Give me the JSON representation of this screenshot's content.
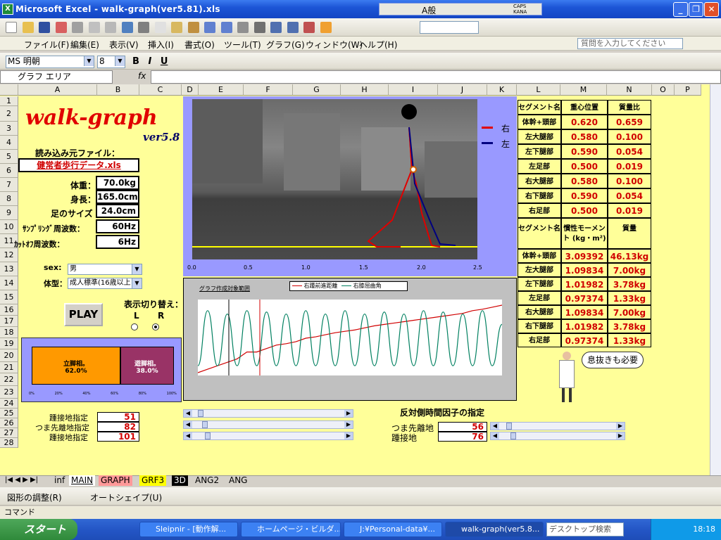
{
  "window": {
    "title": "Microsoft Excel - walk-graph(ver5.81).xls",
    "ime_mode": "A般",
    "caps": "CAPS",
    "kana": "KANA"
  },
  "menu": {
    "items": [
      "ファイル(F)",
      "編集(E)",
      "表示(V)",
      "挿入(I)",
      "書式(O)",
      "ツール(T)",
      "グラフ(G)",
      "ウィンドウ(W)",
      "ヘルプ(H)"
    ],
    "help_placeholder": "質問を入力してください"
  },
  "format": {
    "font": "MS 明朝",
    "size": "8"
  },
  "namebox": "グラフ エリア",
  "fx": "fx",
  "columns": [
    "A",
    "B",
    "C",
    "D",
    "E",
    "F",
    "G",
    "H",
    "I",
    "J",
    "K",
    "L",
    "M",
    "N",
    "O",
    "P"
  ],
  "rows": [
    "1",
    "2",
    "3",
    "4",
    "5",
    "6",
    "7",
    "8",
    "9",
    "10",
    "11",
    "12",
    "13",
    "14",
    "15",
    "16",
    "17",
    "18",
    "19",
    "20",
    "21",
    "22",
    "23",
    "24",
    "25",
    "26",
    "27",
    "28"
  ],
  "sheet": {
    "title": "walk-graph",
    "version": "ver5.8",
    "source_label": "読み込み元ファイル：",
    "source_file": "健常者歩行データ.xls",
    "params": [
      {
        "label": "体重：",
        "value": "70.0kg"
      },
      {
        "label": "身長：",
        "value": "165.0cm"
      },
      {
        "label": "足のサイズ",
        "value": "24.0cm"
      },
      {
        "label": "ｻﾝﾌﾟﾘﾝｸﾞ周波数：",
        "value": "60Hz"
      },
      {
        "label": "ｶｯﾄｵﾌ周波数：",
        "value": "6Hz"
      }
    ],
    "sex_label": "sex:",
    "sex_value": "男",
    "body_label": "体型：",
    "body_value": "成人標準(16歳以上",
    "play": "PLAY",
    "switch_label": "表示切り替え：",
    "switch_L": "L",
    "switch_R": "R",
    "stance_label": "立脚相。",
    "stance_value": "62.0%",
    "swing_label": "遊脚相。",
    "swing_value": "38.0%",
    "phase_ticks": [
      "0%",
      "20%",
      "40%",
      "60%",
      "80%",
      "100%"
    ],
    "frames": [
      {
        "label": "踵接地指定",
        "value": "51"
      },
      {
        "label": "つま先離地指定",
        "value": "82"
      },
      {
        "label": "踵接地指定",
        "value": "101"
      }
    ],
    "opp_title": "反対側時間因子の指定",
    "opp_frames": [
      {
        "label": "つま先離地",
        "value": "56"
      },
      {
        "label": "踵接地",
        "value": "76"
      }
    ]
  },
  "segment_table": {
    "headers": [
      "セグメント名",
      "重心位置",
      "質量比"
    ],
    "rows": [
      [
        "体幹+頭部",
        "0.620",
        "0.659"
      ],
      [
        "左大腿部",
        "0.580",
        "0.100"
      ],
      [
        "左下腿部",
        "0.590",
        "0.054"
      ],
      [
        "左足部",
        "0.500",
        "0.019"
      ],
      [
        "右大腿部",
        "0.580",
        "0.100"
      ],
      [
        "右下腿部",
        "0.590",
        "0.054"
      ],
      [
        "右足部",
        "0.500",
        "0.019"
      ]
    ],
    "headers2": [
      "セグメント名",
      "慣性モーメント (kg・m²)",
      "質量"
    ],
    "rows2": [
      [
        "体幹+頭部",
        "3.09392",
        "46.13kg"
      ],
      [
        "左大腿部",
        "1.09834",
        "7.00kg"
      ],
      [
        "左下腿部",
        "1.01982",
        "3.78kg"
      ],
      [
        "左足部",
        "0.97374",
        "1.33kg"
      ],
      [
        "右大腿部",
        "1.09834",
        "7.00kg"
      ],
      [
        "右下腿部",
        "1.01982",
        "3.78kg"
      ],
      [
        "右足部",
        "0.97374",
        "1.33kg"
      ]
    ]
  },
  "stick_chart": {
    "legend": [
      {
        "name": "右",
        "color": "#e00000"
      },
      {
        "name": "左",
        "color": "#000080"
      }
    ],
    "x_ticks": [
      "0.0",
      "0.5",
      "1.0",
      "1.5",
      "2.0",
      "2.5"
    ]
  },
  "chart_data": {
    "type": "line",
    "title": "グラフ作成対象範囲",
    "series": [
      {
        "name": "右踵前進距離",
        "color": "#d00000",
        "values": [
          0.0,
          0.05,
          0.1,
          0.15,
          0.2,
          0.3,
          0.3,
          0.35,
          0.4,
          0.42,
          0.45,
          0.5,
          0.52,
          0.55,
          0.58,
          0.6,
          0.62,
          0.65,
          0.68,
          0.7,
          0.72,
          0.74,
          0.76,
          0.78,
          0.8,
          0.82,
          0.84,
          0.86,
          0.9,
          0.92,
          0.95,
          0.98
        ]
      },
      {
        "name": "右膝屈曲角",
        "color": "#008060",
        "values": [
          0.1,
          0.9,
          0.1,
          0.85,
          0.1,
          0.9,
          0.1,
          0.88,
          0.1,
          0.85,
          0.1,
          0.9,
          0.1,
          0.85,
          0.1,
          0.9,
          0.1,
          0.85,
          0.1,
          0.88,
          0.1,
          0.85,
          0.1,
          0.9,
          0.1,
          0.88,
          0.1,
          0.85,
          0.1,
          0.9,
          0.1,
          0.7
        ]
      }
    ]
  },
  "speech": "息抜きも必要",
  "sheet_tabs": [
    "inf",
    "MAIN",
    "GRAPH",
    "GRF3",
    "3D",
    "ANG2",
    "ANG"
  ],
  "draw": {
    "adjust": "図形の調整(R)",
    "autoshape": "オートシェイプ(U)"
  },
  "status": "コマンド",
  "taskbar": {
    "start": "スタート",
    "tasks": [
      "Sleipnir - [動作解...",
      "ホームページ・ビルダ...",
      "J:¥Personal-data¥...",
      "walk-graph(ver5.8..."
    ],
    "search_placeholder": "デスクトップ検索",
    "clock": "18:18"
  }
}
